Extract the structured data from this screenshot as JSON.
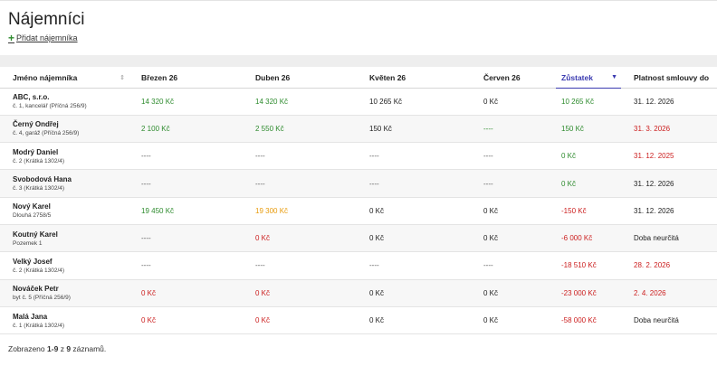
{
  "page": {
    "title": "Nájemníci",
    "add_tenant_label": "Přidat nájemníka"
  },
  "table": {
    "columns": [
      {
        "label": "Jméno nájemníka"
      },
      {
        "label": "Březen 26"
      },
      {
        "label": "Duben 26"
      },
      {
        "label": "Květen 26"
      },
      {
        "label": "Červen 26"
      },
      {
        "label": "Zůstatek"
      },
      {
        "label": "Platnost smlouvy do"
      }
    ],
    "rows": [
      {
        "name": "ABC, s.r.o.",
        "sub": "č. 1, kancelář (Příčná 256/9)",
        "m1": "14 320 Kč",
        "m2": "14 320 Kč",
        "m3": "10 265 Kč",
        "m4": "0 Kč",
        "balance": "10 265 Kč",
        "validity": "31. 12. 2026"
      },
      {
        "name": "Černý Ondřej",
        "sub": "č. 4, garáž (Příčná 256/9)",
        "m1": "2 100 Kč",
        "m2": "2 550 Kč",
        "m3": "150 Kč",
        "m4": "----",
        "balance": "150 Kč",
        "validity": "31. 3. 2026"
      },
      {
        "name": "Modrý Daniel",
        "sub": "č. 2 (Krátká 1302/4)",
        "m1": "----",
        "m2": "----",
        "m3": "----",
        "m4": "----",
        "balance": "0 Kč",
        "validity": "31. 12. 2025"
      },
      {
        "name": "Svobodová Hana",
        "sub": "č. 3 (Krátká 1302/4)",
        "m1": "----",
        "m2": "----",
        "m3": "----",
        "m4": "----",
        "balance": "0 Kč",
        "validity": "31. 12. 2026"
      },
      {
        "name": "Nový Karel",
        "sub": "Dlouhá 2758/5",
        "m1": "19 450 Kč",
        "m2": "19 300 Kč",
        "m3": "0 Kč",
        "m4": "0 Kč",
        "balance": "-150 Kč",
        "validity": "31. 12. 2026"
      },
      {
        "name": "Koutný Karel",
        "sub": "Pozemek 1",
        "m1": "----",
        "m2": "0 Kč",
        "m3": "0 Kč",
        "m4": "0 Kč",
        "balance": "-6 000 Kč",
        "validity": "Doba neurčitá"
      },
      {
        "name": "Velký Josef",
        "sub": "č. 2 (Krátká 1302/4)",
        "m1": "----",
        "m2": "----",
        "m3": "----",
        "m4": "----",
        "balance": "-18 510 Kč",
        "validity": "28. 2. 2026"
      },
      {
        "name": "Nováček Petr",
        "sub": "byt č. 5 (Příčná 256/9)",
        "m1": "0 Kč",
        "m2": "0 Kč",
        "m3": "0 Kč",
        "m4": "0 Kč",
        "balance": "-23 000 Kč",
        "validity": "2. 4. 2026"
      },
      {
        "name": "Malá Jana",
        "sub": "č. 1 (Krátká 1302/4)",
        "m1": "0 Kč",
        "m2": "0 Kč",
        "m3": "0 Kč",
        "m4": "0 Kč",
        "balance": "-58 000 Kč",
        "validity": "Doba neurčitá"
      }
    ]
  },
  "footer": {
    "prefix": "Zobrazeno",
    "range": "1-9",
    "middle": "z",
    "total": "9",
    "suffix": "záznamů."
  },
  "colors": {
    "paid": "#2e8b2e",
    "unpaid": "#cc2020",
    "partial": "#e89b0c",
    "sort_accent": "#3a3ab0"
  }
}
